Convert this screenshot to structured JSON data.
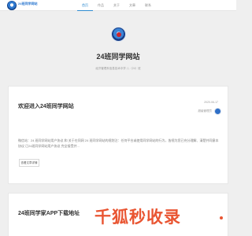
{
  "header": {
    "logo_text": "24班同学网站",
    "logo_sub": "",
    "nav": [
      {
        "label": "首页",
        "active": true
      },
      {
        "label": "作品",
        "active": false
      },
      {
        "label": "关于",
        "active": false
      },
      {
        "label": "文章",
        "active": false
      },
      {
        "label": "联系",
        "active": false
      }
    ]
  },
  "hero": {
    "title": "24班同学网站",
    "description": "经济管理系信息技术中学 八（24）班"
  },
  "posts": [
    {
      "title": "欢迎进入24班同学网站",
      "date": "2020-06-17",
      "author": "超级管理员",
      "excerpt": "微信站：24 班同学网站用户协议 和 关于在同网 24 班同学网站的规划注：任何平台或使用同学网站的行为，皆视为您已充分理解、清楚并同意本协议 已24班同学网站用户协议 完全接受并...",
      "read_more": "查看文章详情"
    },
    {
      "title": "24班同学家APP下载地址"
    }
  ],
  "watermark": {
    "text": "千狐秒收录"
  },
  "colors": {
    "accent": "#2f8bd0",
    "watermark": "#e95532",
    "background": "#efefef"
  }
}
